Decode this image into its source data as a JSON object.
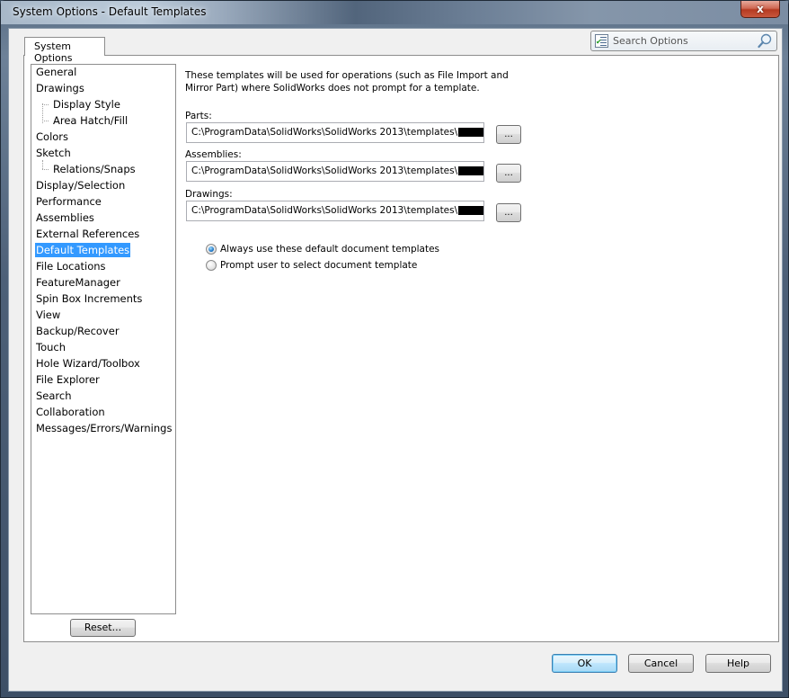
{
  "window": {
    "title": "System Options - Default Templates",
    "close_label": "x"
  },
  "tabs": [
    {
      "label": "System Options",
      "active": true
    }
  ],
  "search": {
    "placeholder": "Search Options"
  },
  "tree": {
    "items": [
      {
        "label": "General",
        "level": 0
      },
      {
        "label": "Drawings",
        "level": 0
      },
      {
        "label": "Display Style",
        "level": 1
      },
      {
        "label": "Area Hatch/Fill",
        "level": 1
      },
      {
        "label": "Colors",
        "level": 0
      },
      {
        "label": "Sketch",
        "level": 0
      },
      {
        "label": "Relations/Snaps",
        "level": 1
      },
      {
        "label": "Display/Selection",
        "level": 0
      },
      {
        "label": "Performance",
        "level": 0
      },
      {
        "label": "Assemblies",
        "level": 0
      },
      {
        "label": "External References",
        "level": 0
      },
      {
        "label": "Default Templates",
        "level": 0,
        "selected": true
      },
      {
        "label": "File Locations",
        "level": 0
      },
      {
        "label": "FeatureManager",
        "level": 0
      },
      {
        "label": "Spin Box Increments",
        "level": 0
      },
      {
        "label": "View",
        "level": 0
      },
      {
        "label": "Backup/Recover",
        "level": 0
      },
      {
        "label": "Touch",
        "level": 0
      },
      {
        "label": "Hole Wizard/Toolbox",
        "level": 0
      },
      {
        "label": "File Explorer",
        "level": 0
      },
      {
        "label": "Search",
        "level": 0
      },
      {
        "label": "Collaboration",
        "level": 0
      },
      {
        "label": "Messages/Errors/Warnings",
        "level": 0
      }
    ],
    "reset_label": "Reset..."
  },
  "main": {
    "description": "These templates will be used for operations (such as File Import and Mirror Part) where SolidWorks does not prompt for a template.",
    "fields": [
      {
        "label": "Parts:",
        "value": "C:\\ProgramData\\SolidWorks\\SolidWorks 2013\\templates\\",
        "browse_label": "..."
      },
      {
        "label": "Assemblies:",
        "value": "C:\\ProgramData\\SolidWorks\\SolidWorks 2013\\templates\\",
        "browse_label": "..."
      },
      {
        "label": "Drawings:",
        "value": "C:\\ProgramData\\SolidWorks\\SolidWorks 2013\\templates\\",
        "browse_label": "..."
      }
    ],
    "options": [
      {
        "label": "Always use these default document templates",
        "checked": true
      },
      {
        "label": "Prompt user to select document template",
        "checked": false
      }
    ]
  },
  "footer": {
    "ok_label": "OK",
    "cancel_label": "Cancel",
    "help_label": "Help"
  }
}
